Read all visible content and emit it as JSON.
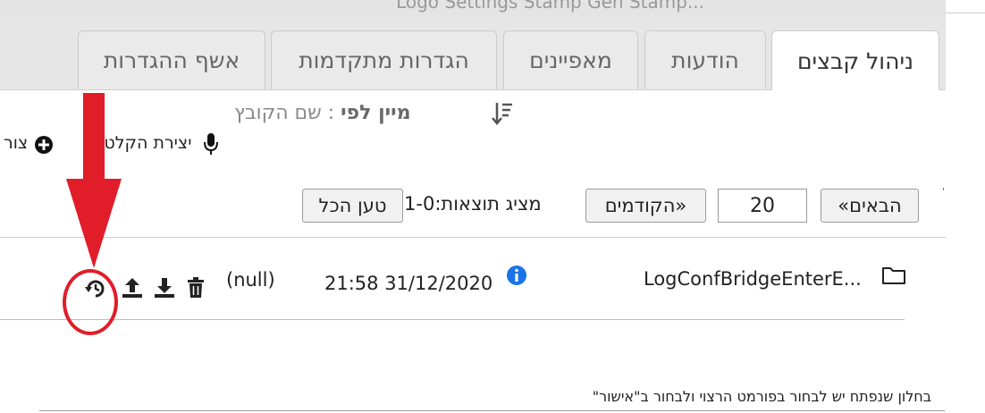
{
  "topbar": {
    "text": "Logo Settings Stamp Gen Stamp..."
  },
  "tabs": [
    {
      "label": "ניהול קבצים",
      "active": true
    },
    {
      "label": "הודעות"
    },
    {
      "label": "מאפיינים"
    },
    {
      "label": "הגדרות מתקדמות"
    },
    {
      "label": "אשף ההגדרות"
    }
  ],
  "toolbar": {
    "sort_prefix": "מיין לפי",
    "sort_value": " : שם הקובץ",
    "create_recording": "יצירת הקלטה",
    "create_short": "צור"
  },
  "pager": {
    "next_label": "«הבאים",
    "page_size": "20",
    "prev_label": "הקודמים»",
    "showing": "מציג תוצאות:1-0",
    "load_all": "טען הכל"
  },
  "file_row": {
    "name": "LogConfBridgeEnterE...",
    "datetime": "21:58 31/12/2020",
    "value": "(null)"
  },
  "footer": {
    "instruction": "בחלון שנפתח יש לבחור בפורמט הרצוי ולבחור ב\"אישור\""
  },
  "colors": {
    "annotation": "#e11d2a",
    "info": "#1a73e8"
  },
  "icons": [
    "folder-icon",
    "info-icon",
    "trash-icon",
    "download-icon",
    "upload-icon",
    "restore-icon",
    "sort-icon",
    "mic-icon",
    "plus-circle-icon"
  ]
}
